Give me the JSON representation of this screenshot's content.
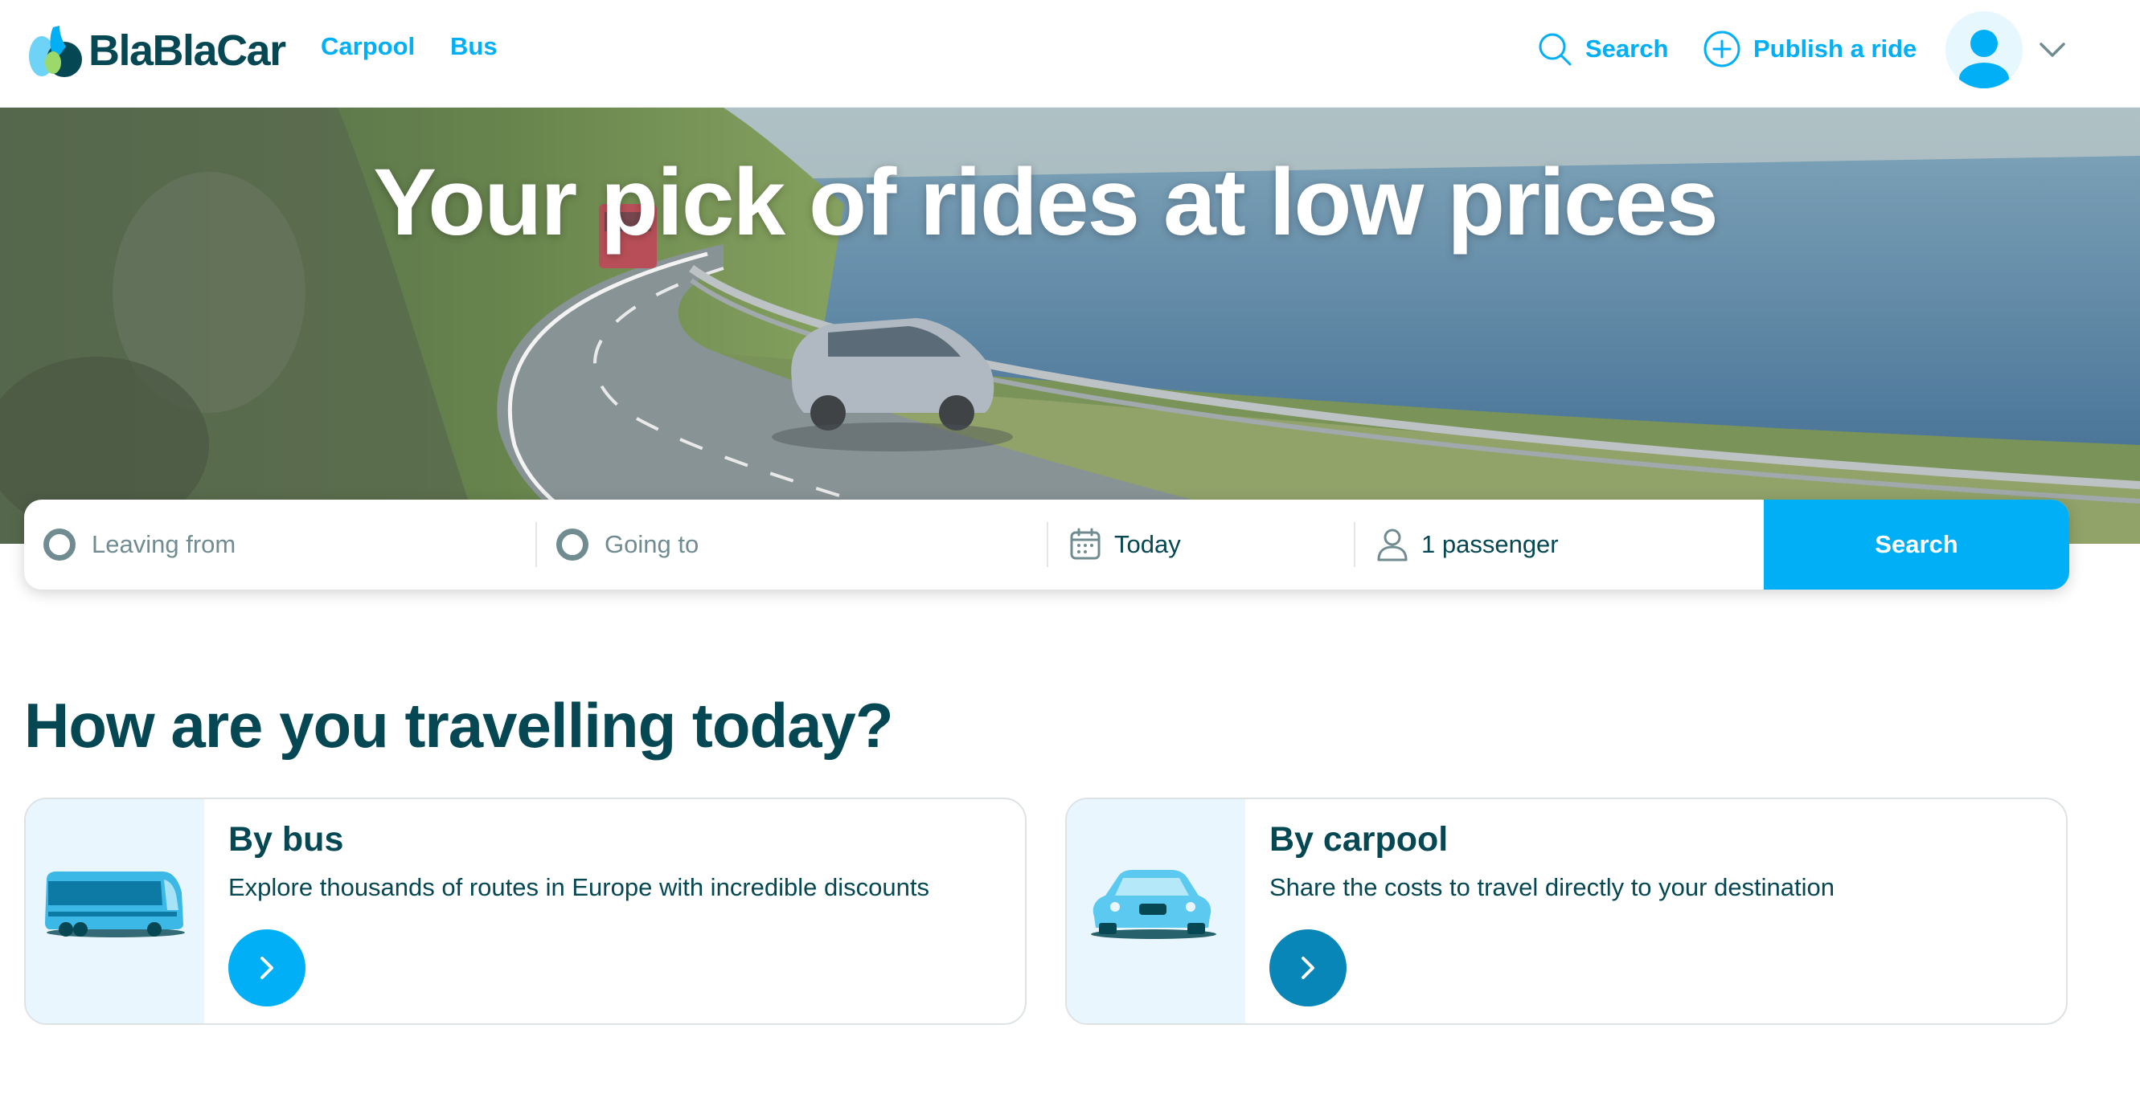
{
  "colors": {
    "brand_blue": "#00aff5",
    "dark_teal": "#054752",
    "muted": "#708c91",
    "carpool_button": "#0986b8"
  },
  "nav": {
    "logo_text": "BlaBlaCar",
    "links": [
      {
        "label": "Carpool"
      },
      {
        "label": "Bus"
      }
    ],
    "search": {
      "label": "Search",
      "icon": "search-icon"
    },
    "publish": {
      "label": "Publish a ride",
      "icon": "plus-circle-icon"
    },
    "profile": {
      "icon": "user-avatar-icon",
      "menu_icon": "chevron-down-icon"
    }
  },
  "hero": {
    "title": "Your pick of rides at low prices"
  },
  "search_bar": {
    "leaving_placeholder": "Leaving from",
    "going_placeholder": "Going to",
    "date_label": "Today",
    "date_icon": "calendar-icon",
    "passengers_label": "1 passenger",
    "passengers_icon": "person-icon",
    "button_label": "Search"
  },
  "section": {
    "title": "How are you travelling today?",
    "cards": [
      {
        "title": "By bus",
        "description": "Explore thousands of routes in Europe with incredible discounts",
        "icon": "bus-icon"
      },
      {
        "title": "By carpool",
        "description": "Share the costs to travel directly to your destination",
        "icon": "car-icon"
      }
    ]
  }
}
